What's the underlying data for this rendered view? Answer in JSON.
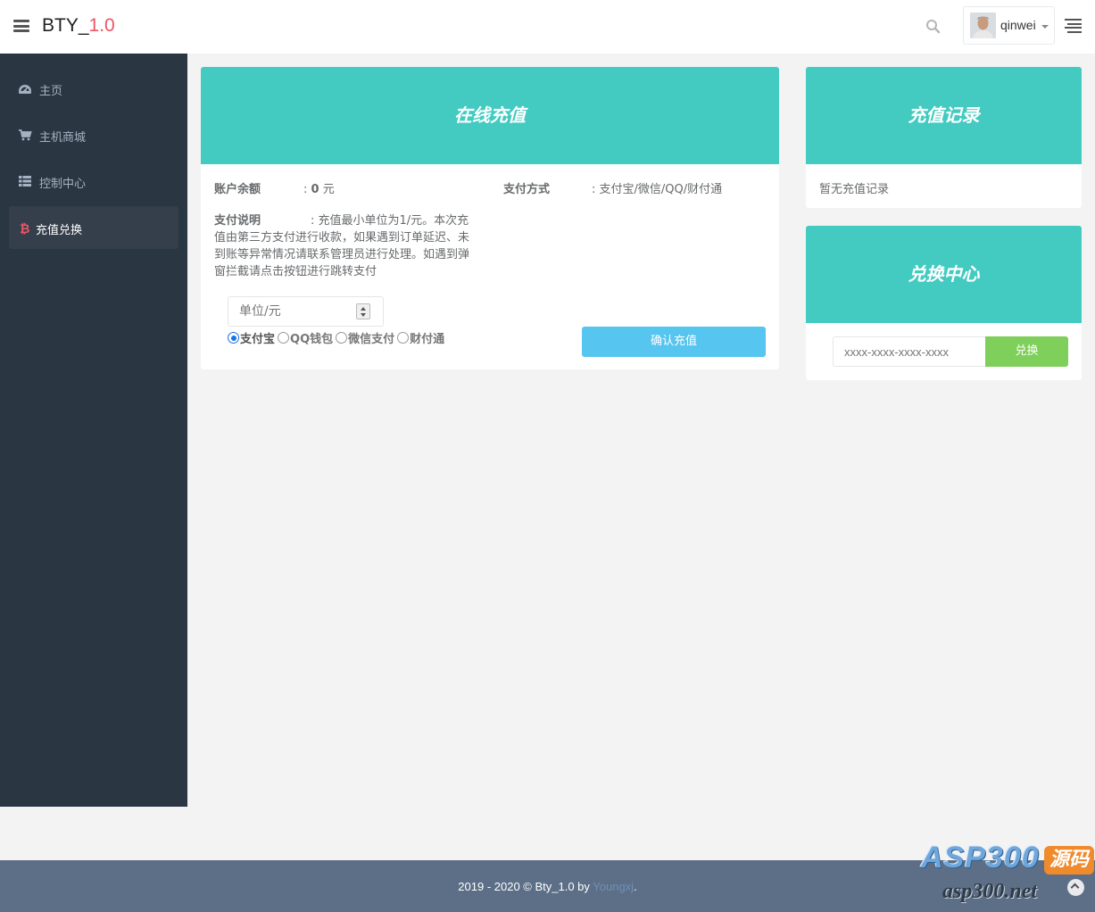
{
  "header": {
    "brand_prefix": "BTY_",
    "brand_version": "1.0",
    "user_name": "qinwei"
  },
  "sidebar": {
    "items": [
      {
        "label": "主页",
        "icon": "dashboard-icon"
      },
      {
        "label": "主机商城",
        "icon": "cart-icon"
      },
      {
        "label": "控制中心",
        "icon": "grid-list-icon"
      },
      {
        "label": "充值兑换",
        "icon": "bitcoin-icon",
        "active": true
      }
    ]
  },
  "recharge": {
    "title": "在线充值",
    "balance_label": "账户余额",
    "balance_prefix": ": ",
    "balance_value": "0",
    "balance_unit": " 元",
    "pay_method_label": "支付方式",
    "pay_method_value": ": 支付宝/微信/QQ/财付通",
    "desc_label": "支付说明",
    "desc_text": ": 充值最小单位为1/元。本次充值由第三方支付进行收款，如果遇到订单延迟、未到账等异常情况请联系管理员进行处理。如遇到弹窗拦截请点击按钮进行跳转支付",
    "amount_placeholder": "单位/元",
    "options": [
      {
        "label": "支付宝",
        "checked": true
      },
      {
        "label": "QQ钱包",
        "checked": false
      },
      {
        "label": "微信支付",
        "checked": false
      },
      {
        "label": "财付通",
        "checked": false
      }
    ],
    "confirm_label": "确认充值"
  },
  "records": {
    "title": "充值记录",
    "empty_text": "暂无充值记录"
  },
  "exchange": {
    "title": "兑换中心",
    "code_placeholder": "xxxx-xxxx-xxxx-xxxx",
    "button_label": "兑换"
  },
  "footer": {
    "text_before": "2019 - 2020 © Bty_1.0 by ",
    "author": "Youngxj",
    "text_after": "."
  },
  "watermark": {
    "top": "ASP300",
    "badge": "源码",
    "bottom": "asp300.net"
  },
  "colors": {
    "teal": "#43cbc1",
    "sidebar": "#2b3643",
    "confirm": "#56c5ef",
    "exchange": "#7ed05a",
    "footer": "#5c6f87",
    "version": "#ed5565"
  }
}
